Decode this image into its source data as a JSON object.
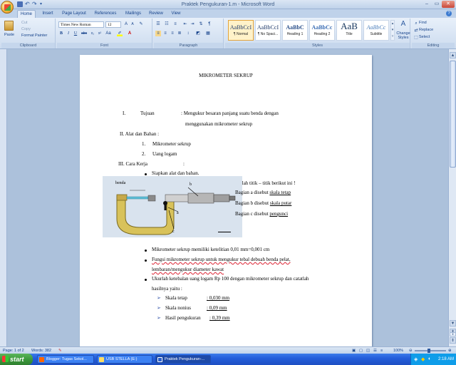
{
  "window": {
    "title": "Praktek Pengukuran-1.m  -  Microsoft Word",
    "min": "–",
    "max": "▭",
    "close": "✕"
  },
  "tabs": [
    "Home",
    "Insert",
    "Page Layout",
    "References",
    "Mailings",
    "Review",
    "View"
  ],
  "ribbon": {
    "clipboard": {
      "paste": "Paste",
      "cut": "Cut",
      "copy": "Copy",
      "format_painter": "Format Painter",
      "label": "Clipboard"
    },
    "font": {
      "name": "Times New Roman",
      "size": "12",
      "label": "Font",
      "bold": "B",
      "italic": "I",
      "underline": "U",
      "grow": "A",
      "shrink": "A"
    },
    "paragraph": {
      "label": "Paragraph"
    },
    "styles": {
      "label": "Styles",
      "items": [
        {
          "sample": "AaBbCcI",
          "name": "¶ Normal"
        },
        {
          "sample": "AaBbCcI",
          "name": "¶ No Spaci..."
        },
        {
          "sample": "AaBbC",
          "name": "Heading 1"
        },
        {
          "sample": "AaBbCc",
          "name": "Heading 2"
        },
        {
          "sample": "AaB",
          "name": "Title"
        },
        {
          "sample": "AaBbCc",
          "name": "Subtitle"
        }
      ],
      "change_styles": "Change Styles"
    },
    "editing": {
      "find": "Find",
      "replace": "Replace",
      "select": "Select",
      "label": "Editing"
    }
  },
  "document": {
    "title": "MIKROMETER SEKRUP",
    "section1_num": "I.",
    "section1_label": "Tujuan",
    "section1_text_a": ": Mengukur besaran panjang  suatu benda dengan",
    "section1_text_b": "menggunakan mikrometer sekrup",
    "section2": "II.  Alat dan Bahan   :",
    "items2": [
      "Mikrometer sekrup",
      "Uang logam"
    ],
    "items2_nums": [
      "1.",
      "2."
    ],
    "section3": "III.  Cara Kerja",
    "section3_colon": ":",
    "steps": [
      "Siapkan alat dan bahan.",
      "Perhatikan gambar berikut ini ! Kemudian isilah titik – titik berikut ini !"
    ],
    "figure": {
      "label_benda": "benda",
      "label_a": "a",
      "label_b": "b",
      "label_c": "c",
      "parts": [
        {
          "prefix": "Bagian a disebut",
          "value": "skala tetap"
        },
        {
          "prefix": "Bagian b disebut",
          "value": "skala putar"
        },
        {
          "prefix": "Bagian c disebut",
          "value": "pengunci"
        }
      ]
    },
    "bullets2": [
      "Mikrometer sekrup memiliki  ketelitian 0,01 mm=0,001 cm",
      "Fungsi mikrometer sekrup untuk mengukur tebal debuah benda pelat,",
      "lembaran/mengukur diameter kawat",
      "Ukurlah ketebalan uang logam Rp 100 dengan mikrometer sekrup dan catatlah",
      "hasilnya yaitu :"
    ],
    "results": [
      {
        "label": "Skala tetap",
        "value": ": 0,030 mm"
      },
      {
        "label": "Skala nonius",
        "value": ": 0,09 mm"
      },
      {
        "label": "Hasil pengukuran",
        "value": ": 0,39 mm"
      }
    ]
  },
  "status": {
    "page": "Page: 1 of 2",
    "words": "Words: 382",
    "zoom": "100%"
  },
  "taskbar": {
    "start": "start",
    "tasks": [
      "Blogger: Tugas Sekol...",
      "USB STELLA (E:)",
      "Praktek Pengukuran-..."
    ],
    "clock": "2:18 AM"
  },
  "colors": {
    "ribbon": "#cddcef",
    "taskbar": "#245edb",
    "start": "#3c9a3c",
    "spell_error": "#d23"
  }
}
